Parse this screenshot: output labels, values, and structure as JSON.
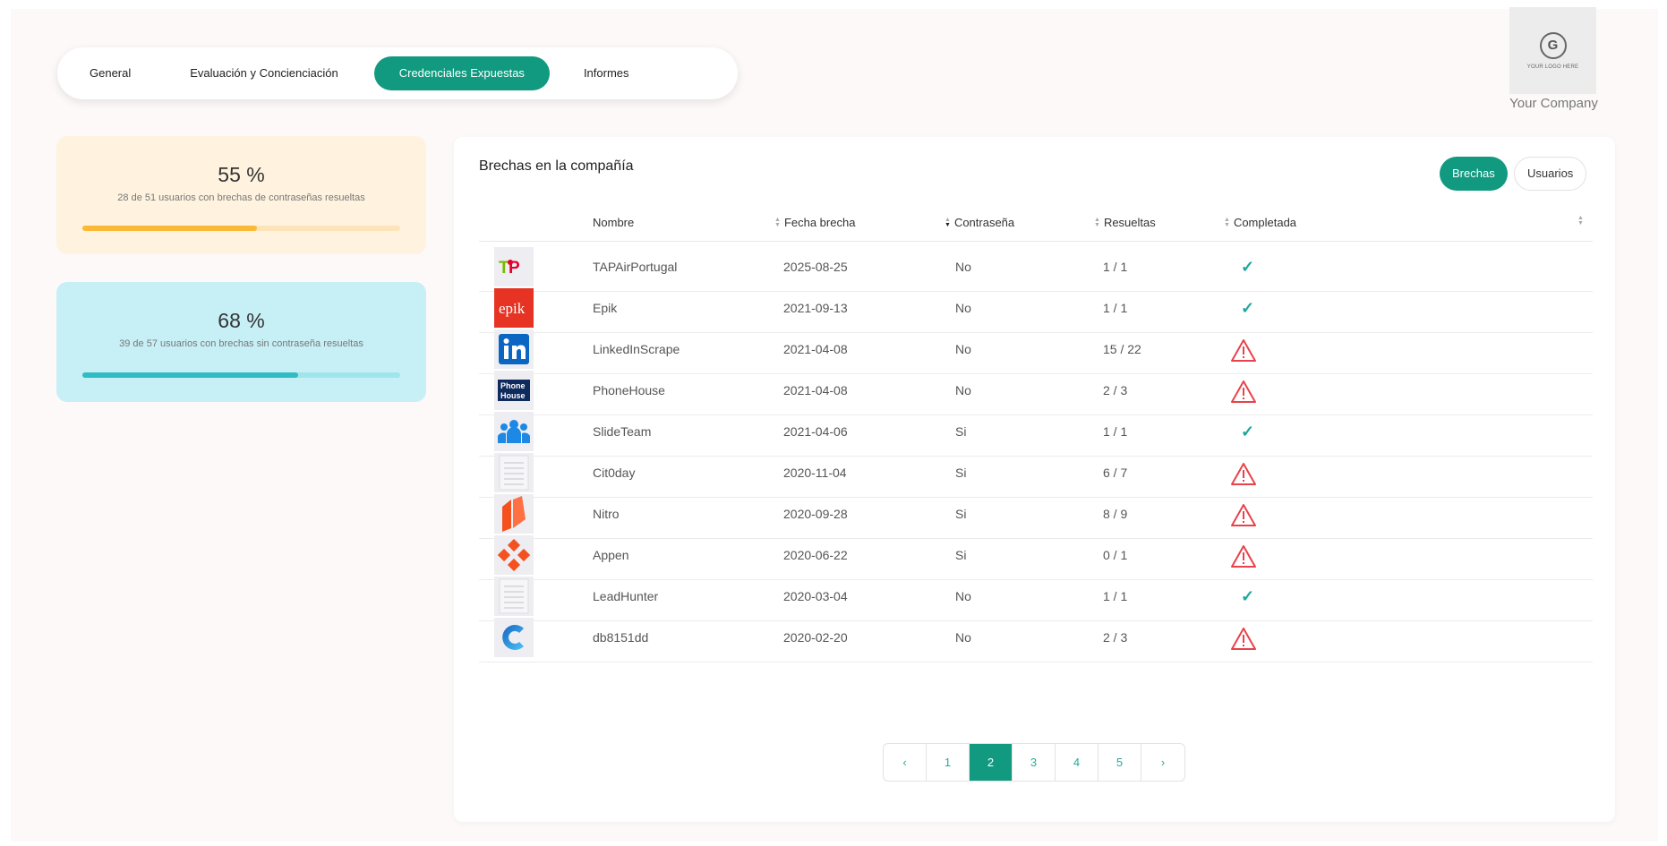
{
  "tabs": [
    {
      "label": "General",
      "active": false
    },
    {
      "label": "Evaluación y Concienciación",
      "active": false
    },
    {
      "label": "Credenciales Expuestas",
      "active": true
    },
    {
      "label": "Informes",
      "active": false
    }
  ],
  "logo": {
    "text": "YOUR LOGO HERE",
    "company": "Your Company"
  },
  "stats": [
    {
      "percent_label": "55 %",
      "description": "28 de 51 usuarios con brechas de contraseñas resueltas",
      "progress": 0.55,
      "color": "#fbb936"
    },
    {
      "percent_label": "68 %",
      "description": "39 de 57 usuarios con brechas sin contraseña resueltas",
      "progress": 0.68,
      "color": "#2fbcc2"
    }
  ],
  "panel": {
    "title": "Brechas en la compañía",
    "toggle_brechas": "Brechas",
    "toggle_usuarios": "Usuarios"
  },
  "columns": {
    "nombre": "Nombre",
    "fecha": "Fecha brecha",
    "contrasena": "Contraseña",
    "resueltas": "Resueltas",
    "completada": "Completada"
  },
  "rows": [
    {
      "name": "TAPAirPortugal",
      "date": "2025-08-25",
      "password": "No",
      "resolved": "1 / 1",
      "status": "complete",
      "icon": "tap-logo-icon"
    },
    {
      "name": "Epik",
      "date": "2021-09-13",
      "password": "No",
      "resolved": "1 / 1",
      "status": "complete",
      "icon": "epik-logo-icon"
    },
    {
      "name": "LinkedInScrape",
      "date": "2021-04-08",
      "password": "No",
      "resolved": "15 / 22",
      "status": "warning",
      "icon": "linkedin-logo-icon"
    },
    {
      "name": "PhoneHouse",
      "date": "2021-04-08",
      "password": "No",
      "resolved": "2 / 3",
      "status": "warning",
      "icon": "phonehouse-logo-icon"
    },
    {
      "name": "SlideTeam",
      "date": "2021-04-06",
      "password": "Si",
      "resolved": "1 / 1",
      "status": "complete",
      "icon": "slideteam-logo-icon"
    },
    {
      "name": "Cit0day",
      "date": "2020-11-04",
      "password": "Si",
      "resolved": "6 / 7",
      "status": "warning",
      "icon": "document-icon"
    },
    {
      "name": "Nitro",
      "date": "2020-09-28",
      "password": "Si",
      "resolved": "8 / 9",
      "status": "warning",
      "icon": "nitro-logo-icon"
    },
    {
      "name": "Appen",
      "date": "2020-06-22",
      "password": "Si",
      "resolved": "0 / 1",
      "status": "warning",
      "icon": "appen-logo-icon"
    },
    {
      "name": "LeadHunter",
      "date": "2020-03-04",
      "password": "No",
      "resolved": "1 / 1",
      "status": "complete",
      "icon": "document-icon"
    },
    {
      "name": "db8151dd",
      "date": "2020-02-20",
      "password": "No",
      "resolved": "2 / 3",
      "status": "warning",
      "icon": "db8151dd-logo-icon"
    }
  ],
  "pagination": {
    "prev": "‹",
    "next": "›",
    "pages": [
      "1",
      "2",
      "3",
      "4",
      "5"
    ],
    "current": "2"
  },
  "colors": {
    "accent": "#119a80",
    "check": "#1aa69a",
    "warning": "#e8424a"
  }
}
